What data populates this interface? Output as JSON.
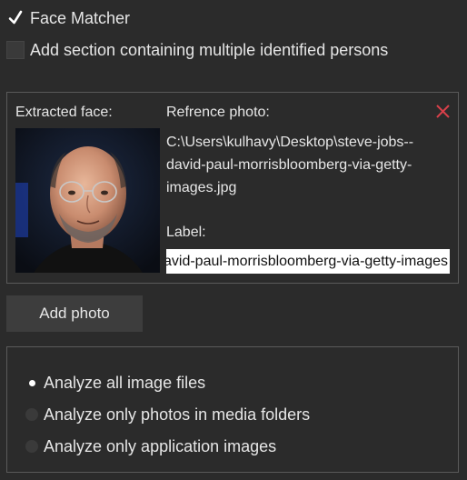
{
  "face_matcher": {
    "label": "Face Matcher",
    "checked": true
  },
  "multiple_persons": {
    "label": "Add section containing multiple identified persons",
    "checked": false
  },
  "face_panel": {
    "extracted_label": "Extracted face:",
    "reference_label": "Refrence photo:",
    "reference_path": "C:\\Users\\kulhavy\\Desktop\\steve-jobs--david-paul-morrisbloomberg-via-getty-images.jpg",
    "label_caption": "Label:",
    "label_value": "steve-jobs--david-paul-morrisbloomberg-via-getty-images",
    "close_icon": "close-icon",
    "accent_color": "#d9404a"
  },
  "add_photo": {
    "label": "Add photo"
  },
  "analyze_options": {
    "items": [
      {
        "label": "Analyze all image files",
        "selected": true
      },
      {
        "label": "Analyze only photos in media folders",
        "selected": false
      },
      {
        "label": "Analyze only application images",
        "selected": false
      }
    ]
  }
}
